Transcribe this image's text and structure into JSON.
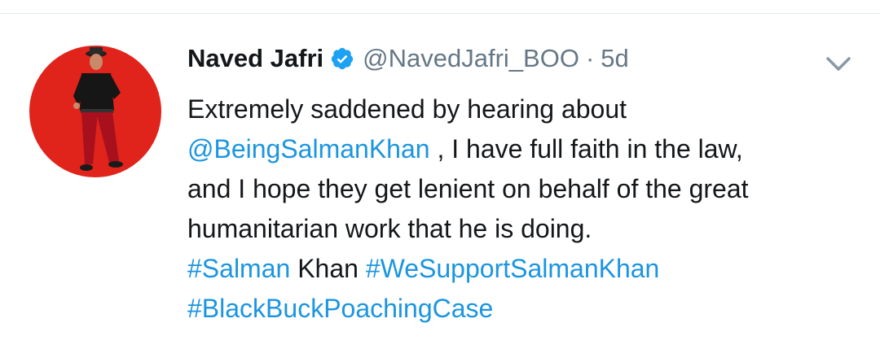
{
  "tweet": {
    "author_name": "Naved Jafri",
    "handle": "@NavedJafri_BOO",
    "separator": "·",
    "time": "5d",
    "verified": true,
    "avatar_bg": "#e0241b",
    "link_color": "#1b95e0",
    "body": {
      "line1": "Extremely saddened by hearing about",
      "mention": "@BeingSalmanKhan",
      "line2_rest": " , I have full faith in the law,",
      "line3": "and I hope they get lenient on behalf of the great",
      "line4": "humanitarian work that he is doing.",
      "hashtag1": "#Salman",
      "plain1": " Khan ",
      "hashtag2": "#WeSupportSalmanKhan",
      "hashtag3": "#BlackBuckPoachingCase"
    },
    "icons": {
      "verified": "verified-badge-icon",
      "menu": "chevron-down-icon"
    }
  }
}
